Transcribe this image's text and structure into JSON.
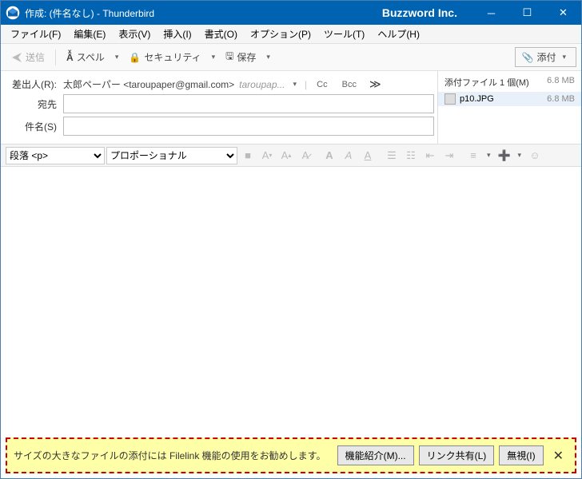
{
  "titlebar": {
    "title": "作成: (件名なし) - Thunderbird",
    "brand": "Buzzword Inc."
  },
  "menu": {
    "file": "ファイル(F)",
    "edit": "編集(E)",
    "view": "表示(V)",
    "insert": "挿入(I)",
    "format": "書式(O)",
    "options": "オプション(P)",
    "tools": "ツール(T)",
    "help": "ヘルプ(H)"
  },
  "toolbar": {
    "send": "送信",
    "spell": "スペル",
    "security": "セキュリティ",
    "save": "保存",
    "attach": "添付"
  },
  "compose": {
    "fromLabel": "差出人(R):",
    "from": "太郎ペーパー <taroupaper@gmail.com>",
    "fromExtra": "taroupap...",
    "toLabel": "宛先",
    "to": "",
    "subjectLabel": "件名(S)",
    "subject": "",
    "cc": "Cc",
    "bcc": "Bcc"
  },
  "attach": {
    "header": "添付ファイル 1 個(M)",
    "totalSize": "6.8 MB",
    "file": "p10.JPG",
    "fileSize": "6.8 MB"
  },
  "format": {
    "para": "段落 <p>",
    "font": "プロポーショナル"
  },
  "notify": {
    "msg": "サイズの大きなファイルの添付には Filelink 機能の使用をお勧めします。",
    "btn1": "機能紹介(M)...",
    "btn2": "リンク共有(L)",
    "btn3": "無視(I)"
  }
}
